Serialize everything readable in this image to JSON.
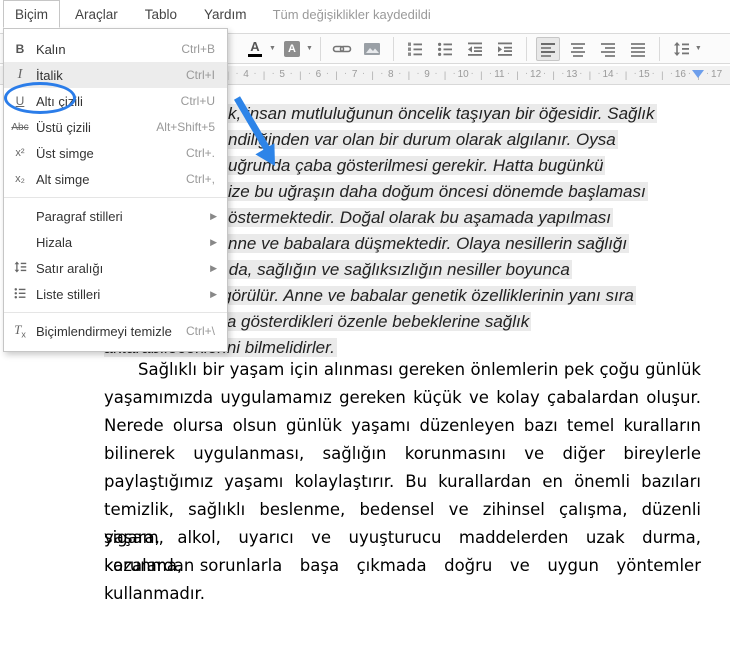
{
  "menubar": {
    "items": [
      {
        "label": "Biçim",
        "open": true
      },
      {
        "label": "Araçlar"
      },
      {
        "label": "Tablo"
      },
      {
        "label": "Yardım"
      }
    ],
    "status": "Tüm değişiklikler kaydedildi"
  },
  "format_menu": {
    "items": [
      {
        "icon": "bold-icon",
        "glyph": "B",
        "label": "Kalın",
        "shortcut": "Ctrl+B"
      },
      {
        "icon": "italic-icon",
        "glyph": "I",
        "label": "İtalik",
        "shortcut": "Ctrl+I",
        "highlighted": true,
        "circled": true
      },
      {
        "icon": "underline-icon",
        "glyph": "U",
        "label": "Altı çizili",
        "shortcut": "Ctrl+U"
      },
      {
        "icon": "strikethrough-icon",
        "glyph": "Abc",
        "label": "Üstü çizili",
        "shortcut": "Alt+Shift+5"
      },
      {
        "icon": "superscript-icon",
        "glyph": "x²",
        "label": "Üst simge",
        "shortcut": "Ctrl+."
      },
      {
        "icon": "subscript-icon",
        "glyph": "x₂",
        "label": "Alt simge",
        "shortcut": "Ctrl+,"
      },
      {
        "separator": true
      },
      {
        "label": "Paragraf stilleri",
        "submenu": true
      },
      {
        "label": "Hizala",
        "submenu": true
      },
      {
        "icon": "line-spacing-icon",
        "label": "Satır aralığı",
        "submenu": true
      },
      {
        "icon": "list-styles-icon",
        "label": "Liste stilleri",
        "submenu": true
      },
      {
        "separator": true
      },
      {
        "icon": "clear-formatting-icon",
        "glyph": "Tx",
        "label": "Biçimlendirmeyi temizle",
        "shortcut": "Ctrl+\\"
      }
    ]
  },
  "toolbar": {
    "icons": [
      "text-color",
      "text-color-caret",
      "highlight-color",
      "highlight-color-caret",
      "link",
      "insert-image",
      "numbered-list",
      "bulleted-list",
      "outdent",
      "indent",
      "align-left",
      "align-center",
      "align-right",
      "justify",
      "line-spacing",
      "line-spacing-caret"
    ],
    "active_icon": "align-left"
  },
  "ruler": {
    "numbers": [
      4,
      5,
      6,
      7,
      8,
      9,
      10,
      11,
      12,
      13,
      14,
      15,
      16,
      17
    ]
  },
  "document": {
    "selected_paragraph_clipped_lines": [
      "k, insan mutluluğunun öncelik taşıyan bir öğesidir. Sağlık",
      "ndiliğinden var olan bir durum olarak algılanır. Oysa",
      "uğrunda çaba gösterilmesi gerekir. Hatta bugünkü",
      "ize bu uğraşın daha doğum öncesi dönemde başlaması",
      "östermektedir. Doğal olarak bu aşamada yapılması",
      "nne ve babalara düşmektedir. Olaya nesillerin sağlığı"
    ],
    "selected_paragraph_full_lines": [
      "olarak bakıldığında, sağlığın ve sağlıksızlığın nesiller boyunca",
      "aktarılabileceği görülür. Anne ve babalar genetik özelliklerinin yanı sıra",
      "kendi sağlıklarına gösterdikleri özenle bebeklerine sağlık",
      "aktarabileceklerini bilmelidirler."
    ],
    "second_paragraph_lines": [
      "Sağlıklı bir yaşam için alınması gereken önlemlerin pek çoğu günlük",
      "yaşamımızda uygulamamız gereken küçük ve kolay çabalardan oluşur.",
      "Nerede olursa olsun günlük yaşamı düzenleyen bazı temel kuralların",
      "bilinerek uygulanması, sağlığın korunmasını ve diğer bireylerle",
      "paylaştığımız yaşamı kolaylaştırır. Bu kurallardan en önemli bazıları",
      "temizlik, sağlıklı beslenme, bedensel ve zihinsel çalışma, düzenli yaşam,",
      "sigara, alkol, uyarıcı ve uyuşturucu maddelerden uzak durma, kazalardan",
      "korunma, sorunlarla başa çıkmada doğru ve uygun yöntemler",
      "kullanmadır."
    ]
  },
  "annotations": {
    "arrow_color": "#2d84e8",
    "ellipse_color": "#2b7de9",
    "selection_color": "#eaeaea"
  }
}
